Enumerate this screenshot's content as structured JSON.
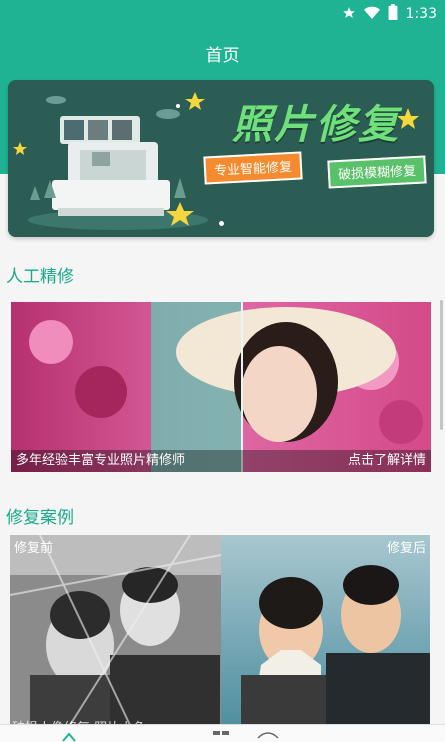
{
  "status_bar": {
    "time": "1:33",
    "icons": [
      "star-icon",
      "wifi-icon",
      "battery-icon"
    ]
  },
  "app_bar": {
    "title": "首页"
  },
  "banner": {
    "title": "照片修复",
    "tags": [
      "专业智能修复",
      "破损模糊修复"
    ]
  },
  "sections": [
    {
      "title": "人工精修",
      "card": {
        "caption_left": "多年经验丰富专业照片精修师",
        "caption_right": "点击了解详情"
      }
    },
    {
      "title": "修复案例",
      "card": {
        "label_before": "修复前",
        "label_after": "修复后",
        "caption": "破损人像修复 照片上色"
      }
    }
  ],
  "bottom_nav": {
    "icons": [
      "home-icon",
      "grid-icon",
      "fish-icon"
    ]
  },
  "colors": {
    "primary": "#1fb394",
    "accent_text": "#1aa98a"
  }
}
